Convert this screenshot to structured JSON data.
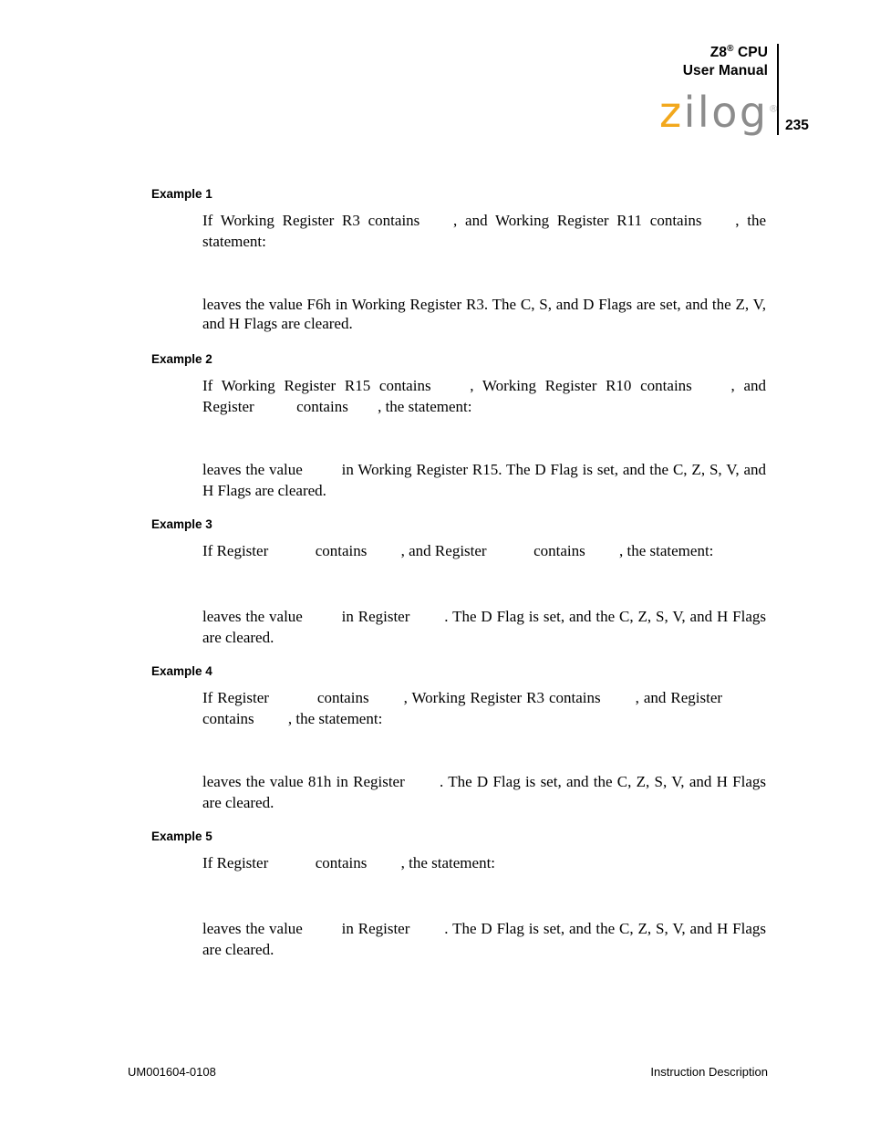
{
  "header": {
    "product_line1": "Z8",
    "product_sup": "®",
    "product_line1_rest": " CPU",
    "product_line2": "User Manual",
    "page_number": "235",
    "logo_z": "z",
    "logo_ilog": "ilog",
    "logo_tm": "®"
  },
  "examples": [
    {
      "heading": "Example 1",
      "setup_parts": [
        "If Working Register R3 contains ",
        ", and Working Register R11 contains ",
        ", the statement:"
      ],
      "statement": "",
      "result": "leaves the value F6h in Working Register R3. The C, S, and D Flags are set, and the Z, V, and H Flags are cleared."
    },
    {
      "heading": "Example 2",
      "setup_parts": [
        "If Working Register R15 contains ",
        ", Working Register R10 contains ",
        ", and Register ",
        " contains ",
        ", the statement:"
      ],
      "statement": "",
      "result_parts": [
        "leaves the value ",
        " in Working Register R15. The D Flag is set, and the C, Z, S, V, and H Flags are cleared."
      ]
    },
    {
      "heading": "Example 3",
      "setup_parts": [
        "If Register ",
        " contains ",
        ", and Register ",
        " contains ",
        ", the statement:"
      ],
      "statement": "",
      "result_parts": [
        "leaves the value ",
        " in Register ",
        ". The D Flag is set, and the C, Z, S, V, and H Flags are cleared."
      ]
    },
    {
      "heading": "Example 4",
      "setup_parts": [
        "If Register ",
        " contains ",
        ", Working Register R3 contains ",
        ", and Register ",
        " contains ",
        ", the statement:"
      ],
      "statement": "",
      "result_parts": [
        "leaves the value 81h in Register ",
        ". The D Flag is set, and the C, Z, S, V, and H Flags are cleared."
      ]
    },
    {
      "heading": "Example 5",
      "setup_parts": [
        "If Register ",
        " contains ",
        ", the statement:"
      ],
      "statement": "",
      "result_parts": [
        "leaves the value ",
        " in Register ",
        ". The D Flag is set, and the C, Z, S, V, and H Flags are cleared."
      ]
    }
  ],
  "footer": {
    "document_id": "UM001604-0108",
    "section_name": "Instruction Description"
  }
}
